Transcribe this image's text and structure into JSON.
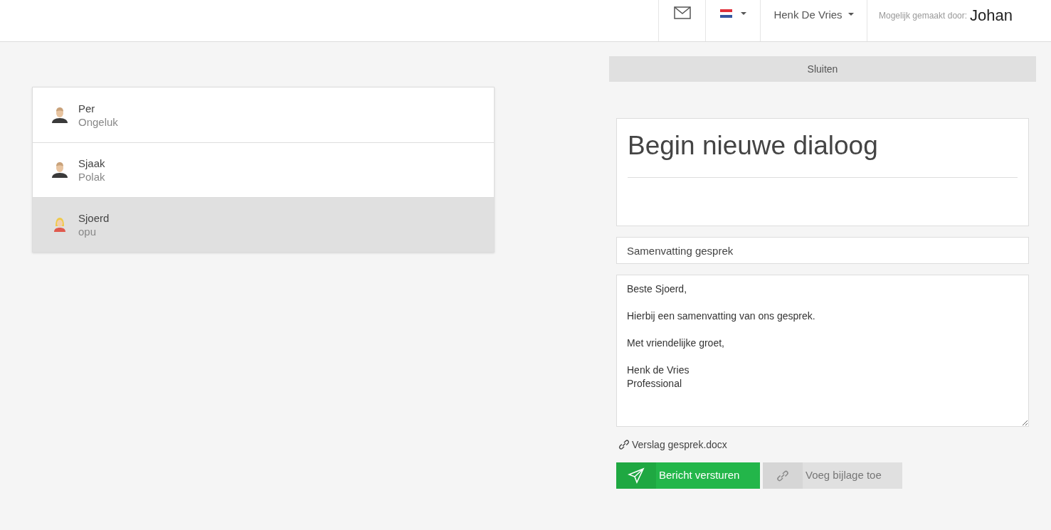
{
  "header": {
    "user": "Henk De Vries",
    "credit_label": "Mogelijk gemaakt door:",
    "credit_name": "Johan"
  },
  "contacts": [
    {
      "name": "Per",
      "subtitle": "Ongeluk",
      "kind": "male",
      "selected": false
    },
    {
      "name": "Sjaak",
      "subtitle": "Polak",
      "kind": "male",
      "selected": false
    },
    {
      "name": "Sjoerd",
      "subtitle": "opu",
      "kind": "female",
      "selected": true
    }
  ],
  "close_button": "Sluiten",
  "dialog": {
    "title": "Begin nieuwe dialoog",
    "subject": "Samenvatting gesprek",
    "body": "Beste Sjoerd,\n\nHierbij een samenvatting van ons gesprek.\n\nMet vriendelijke groet,\n\nHenk de Vries\nProfessional",
    "attachment": "Verslag gesprek.docx",
    "send_button": "Bericht versturen",
    "attach_button": "Voeg bijlage toe"
  }
}
